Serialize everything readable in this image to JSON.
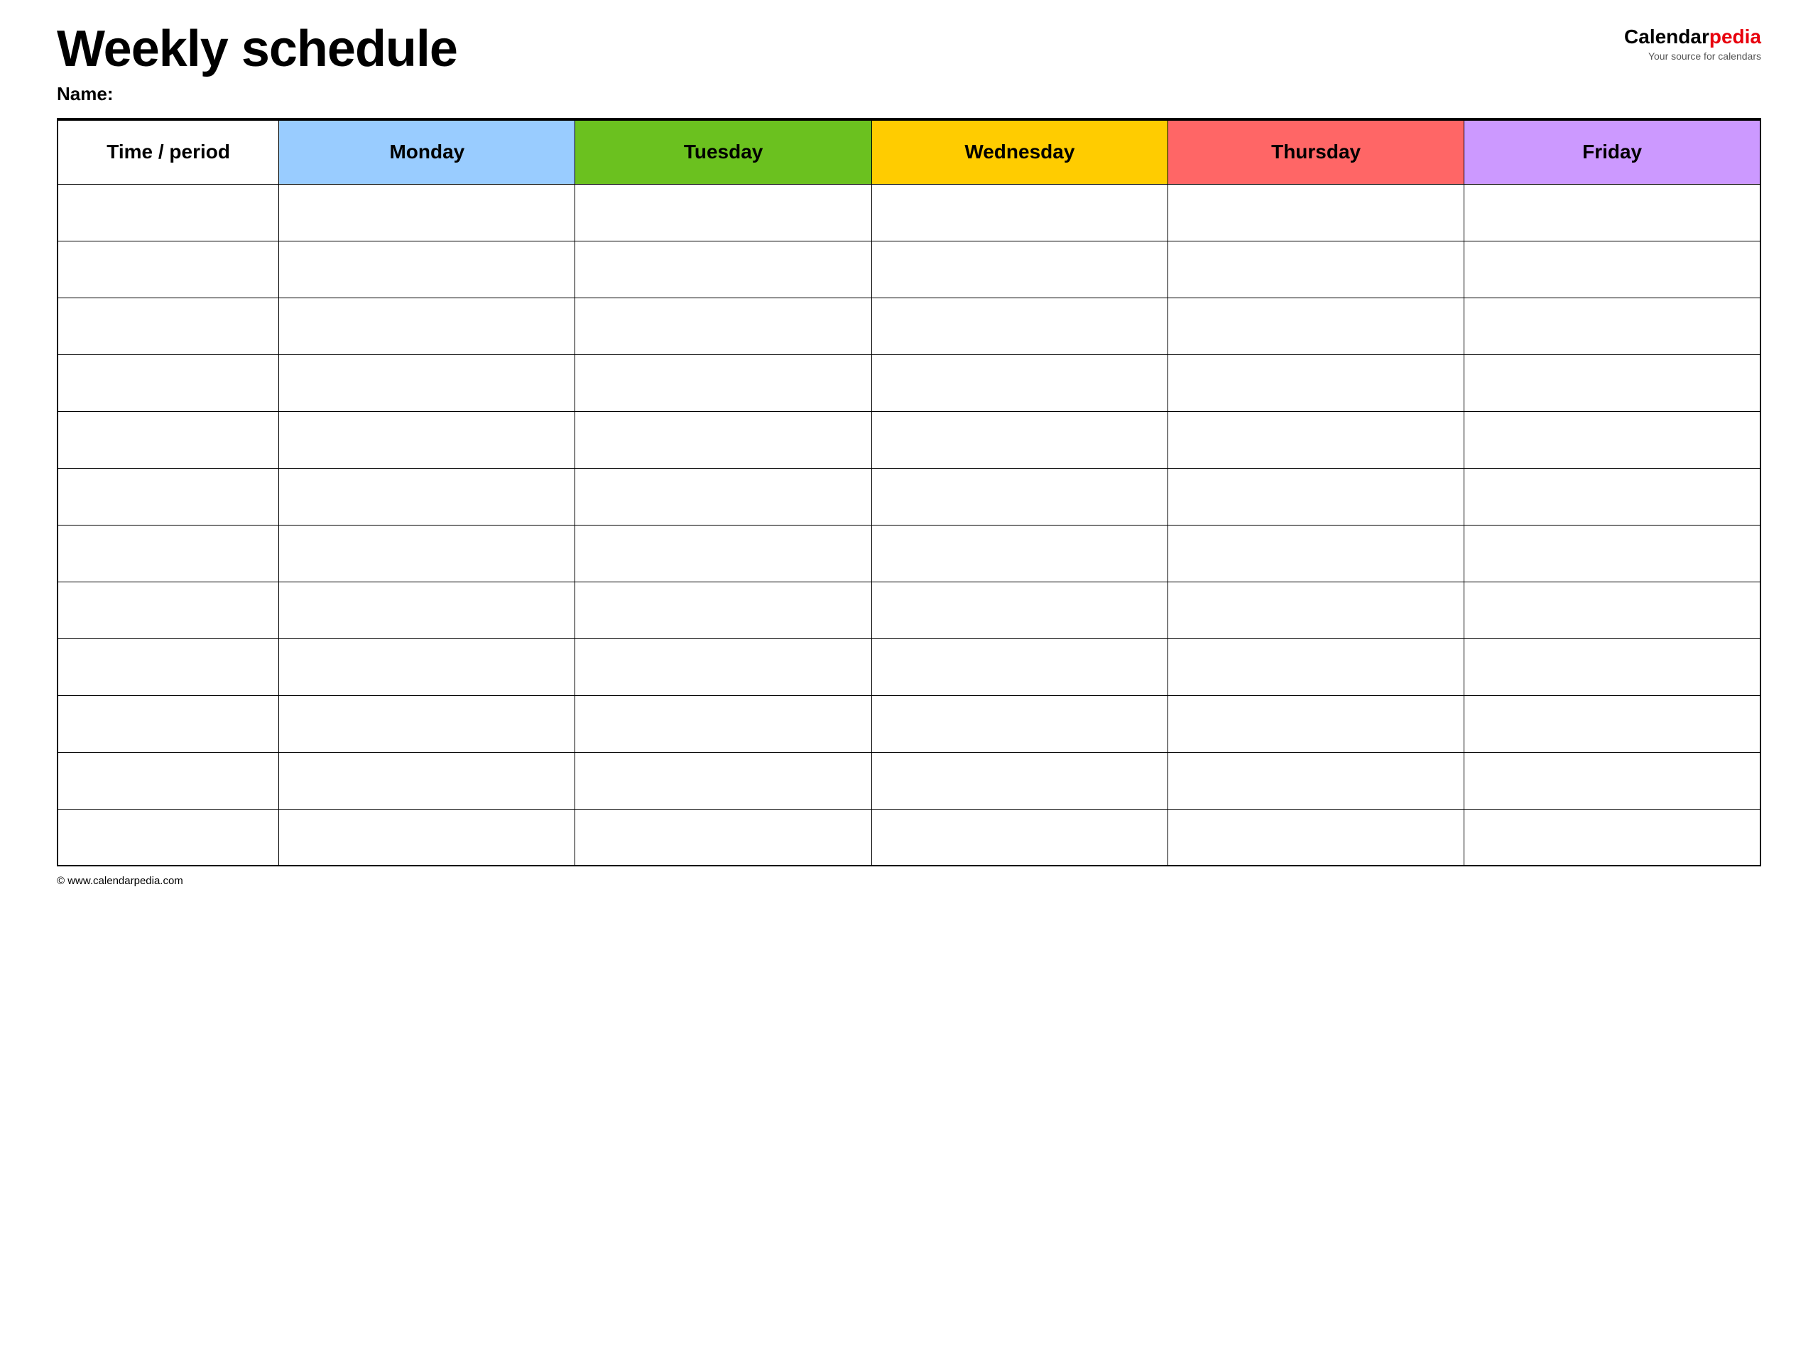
{
  "header": {
    "title": "Weekly schedule",
    "name_label": "Name:",
    "logo": {
      "calendar_part": "Calendar",
      "pedia_part": "pedia",
      "tagline": "Your source for calendars"
    }
  },
  "table": {
    "columns": [
      {
        "key": "time",
        "label": "Time / period",
        "color": "#ffffff",
        "class": "th-time"
      },
      {
        "key": "monday",
        "label": "Monday",
        "color": "#99ccff",
        "class": "th-monday"
      },
      {
        "key": "tuesday",
        "label": "Tuesday",
        "color": "#6bc11f",
        "class": "th-tuesday"
      },
      {
        "key": "wednesday",
        "label": "Wednesday",
        "color": "#ffcc00",
        "class": "th-wednesday"
      },
      {
        "key": "thursday",
        "label": "Thursday",
        "color": "#ff6666",
        "class": "th-thursday"
      },
      {
        "key": "friday",
        "label": "Friday",
        "color": "#cc99ff",
        "class": "th-friday"
      }
    ],
    "row_count": 12
  },
  "footer": {
    "url": "© www.calendarpedia.com"
  }
}
